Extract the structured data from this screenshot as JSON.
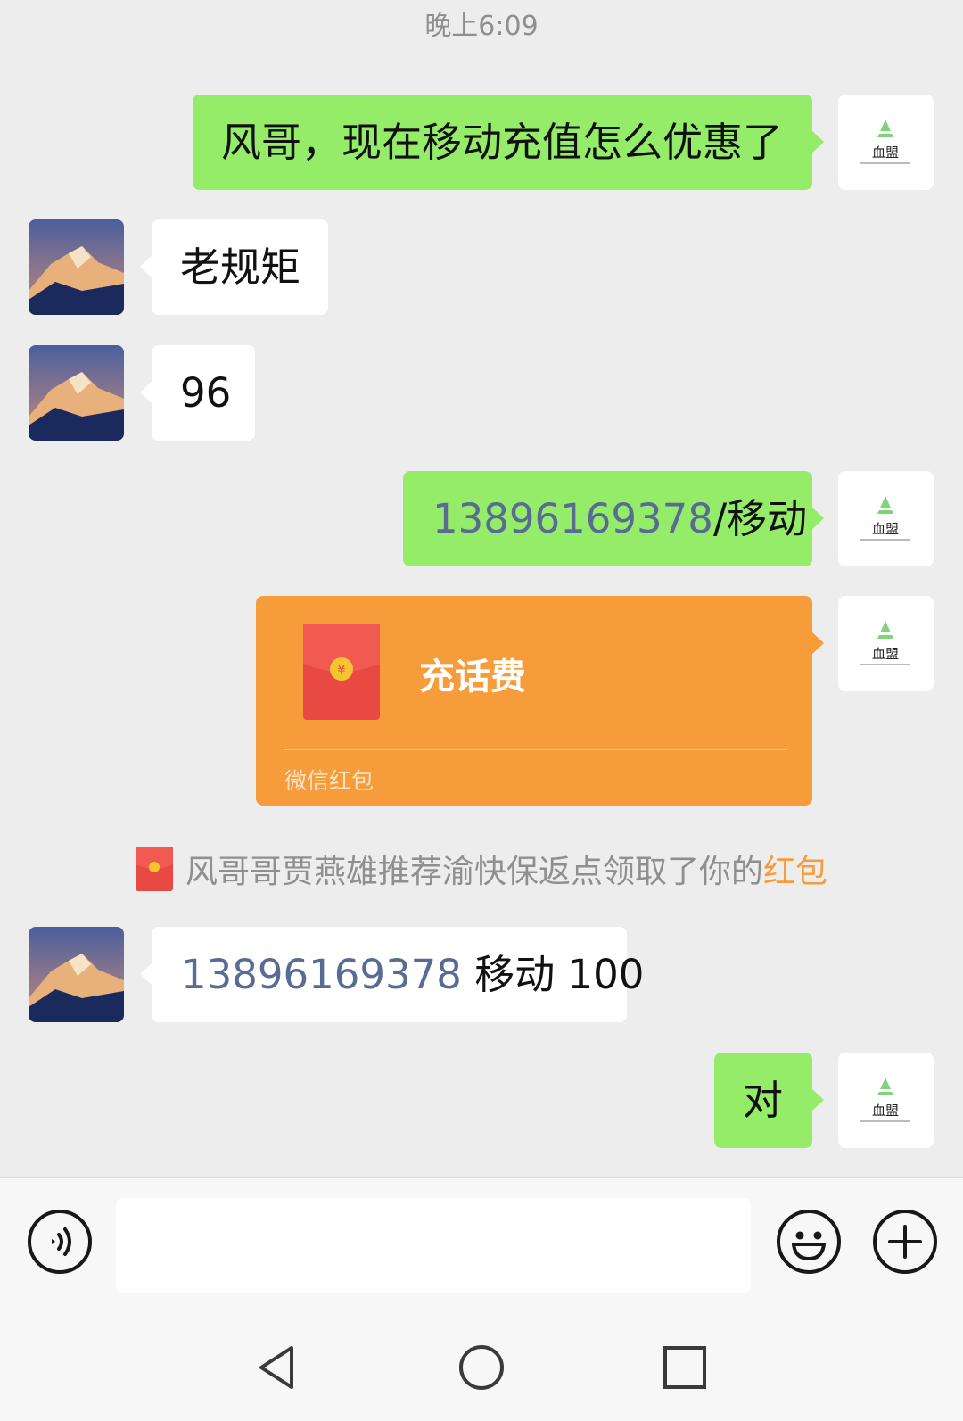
{
  "chat": {
    "timestamp": "晚上6:09",
    "messages": [
      {
        "side": "out",
        "text": "风哥，现在移动充值怎么优惠了"
      },
      {
        "side": "in",
        "text": "老规矩"
      },
      {
        "side": "in",
        "text": "96"
      },
      {
        "side": "out",
        "phone": "13896169378",
        "text": "/移动"
      },
      {
        "side": "out",
        "type": "red_packet",
        "title": "充话费",
        "footer": "微信红包"
      },
      {
        "side": "in",
        "phone": "13896169378",
        "text": " 移动 100"
      },
      {
        "side": "out",
        "text": "对"
      }
    ],
    "system_message": {
      "text": "风哥哥贾燕雄推荐渝快保返点领取了你的",
      "highlight": "红包"
    }
  },
  "self_avatar": {
    "logo_text": "血盟"
  },
  "input_bar": {
    "voice_icon": "voice-icon",
    "emoji_icon": "emoji-icon",
    "plus_icon": "plus-icon",
    "value": ""
  },
  "nav_bar": {
    "back": "back-icon",
    "home": "home-icon",
    "recents": "recents-icon"
  },
  "colors": {
    "background": "#ededed",
    "outgoing_bubble": "#95ec69",
    "incoming_bubble": "#ffffff",
    "red_packet": "#f79c3a",
    "link": "#576b95"
  }
}
